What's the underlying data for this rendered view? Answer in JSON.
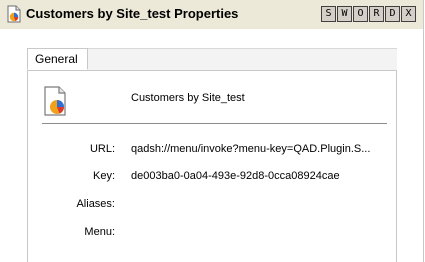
{
  "window": {
    "title": "Customers by Site_test Properties",
    "title_buttons": [
      "S",
      "W",
      "O",
      "R",
      "D",
      "X"
    ]
  },
  "tabs": [
    {
      "label": "General",
      "active": true
    }
  ],
  "general": {
    "name": "Customers by Site_test",
    "fields": [
      {
        "label": "URL:",
        "value": "qadsh://menu/invoke?menu-key=QAD.Plugin.S..."
      },
      {
        "label": "Key:",
        "value": "de003ba0-0a04-493e-92d8-0cca08924cae"
      },
      {
        "label": "Aliases:",
        "value": ""
      },
      {
        "label": "Menu:",
        "value": ""
      }
    ]
  },
  "icons": {
    "app": "properties-document-icon",
    "item": "report-document-icon"
  },
  "colors": {
    "titlebar_bg": "#ece9d8",
    "button_bg": "#d4d0c8",
    "icon_orange": "#f2a11a",
    "icon_blue": "#2f6fd6"
  }
}
